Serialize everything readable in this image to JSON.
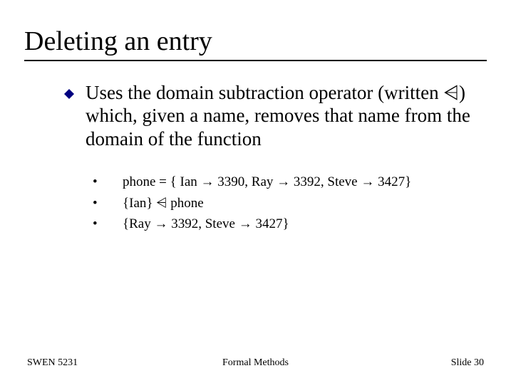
{
  "title": "Deleting an entry",
  "main_bullet": "Uses the domain subtraction operator (written ⩤) which, given a name, removes that name from the domain of the function",
  "sub_bullets": [
    "phone = { Ian → 3390, Ray → 3392, Steve → 3427}",
    "{Ian} ⩤ phone",
    "{Ray → 3392, Steve → 3427}"
  ],
  "footer": {
    "left": "SWEN 5231",
    "center": "Formal Methods",
    "right": "Slide  30"
  }
}
